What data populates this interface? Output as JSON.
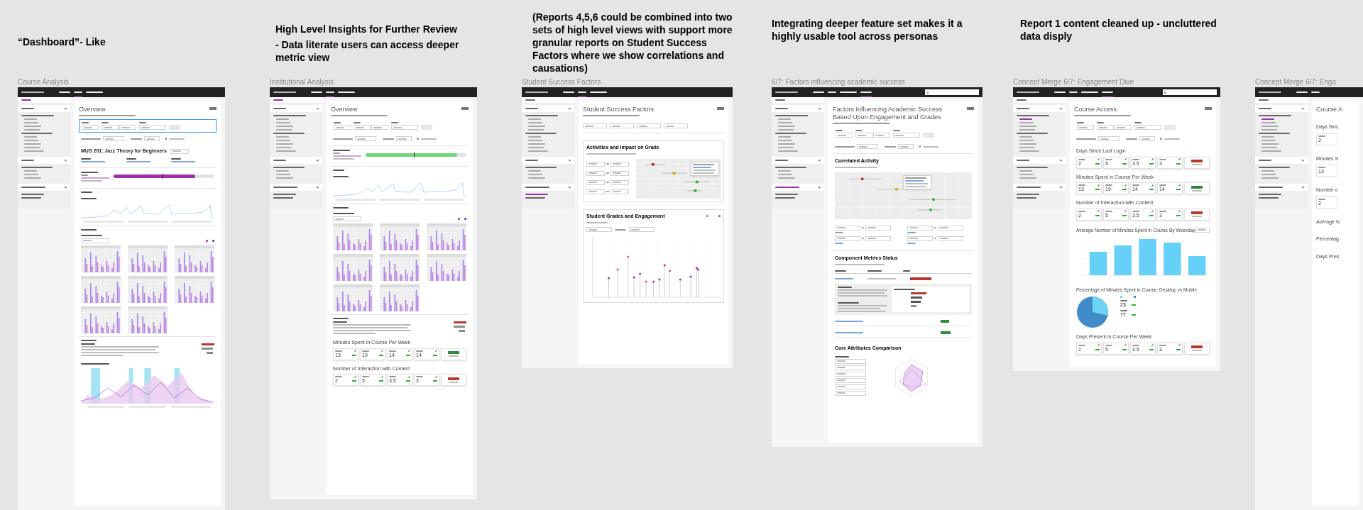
{
  "annotations": [
    {
      "lines": [
        "“Dashboard”- Like"
      ]
    },
    {
      "lines": [
        "High Level Insights for Further Review",
        "- Data literate users can access deeper metric view"
      ]
    },
    {
      "lines": [
        "(Reports 4,5,6 could be combined into two sets of high level views with support more granular reports on Student Success Factors where we show correlations and causations)"
      ]
    },
    {
      "lines": [
        "Integrating deeper feature set makes it a highly usable tool across personas"
      ]
    },
    {
      "lines": [
        "Report 1 content cleaned up - uncluttered data disply"
      ]
    }
  ],
  "frames": [
    {
      "title": "Course Analysis",
      "nav": {
        "kind": "reports"
      },
      "sidebar": {
        "kind": "top"
      },
      "page_title": "Overview",
      "blocks": [
        {
          "kind": "filters",
          "highlighted": true
        },
        {
          "kind": "course",
          "title": "MUS 201: Jazz Theory for Beginners"
        },
        {
          "kind": "enrollment",
          "level": 0.81,
          "color": "#9b2fae"
        },
        {
          "kind": "sparkline"
        },
        {
          "kind": "minigrid"
        },
        {
          "kind": "summary"
        },
        {
          "kind": "area"
        }
      ]
    },
    {
      "title": "Institutional Analysis",
      "nav": {
        "kind": "reports"
      },
      "sidebar": {
        "kind": "top"
      },
      "page_title": "Overview",
      "blocks": [
        {
          "kind": "filters",
          "highlighted": false
        },
        {
          "kind": "enrollment",
          "level": 0.91,
          "color": "#6fd67a"
        },
        {
          "kind": "sparkline"
        },
        {
          "kind": "minigrid"
        },
        {
          "kind": "summary"
        },
        {
          "kind": "metric",
          "title": "Minutes Spent in Course Per Week",
          "values": [
            "13",
            "19",
            "14",
            "14"
          ],
          "status": {
            "color": "#2e8b3a"
          }
        },
        {
          "kind": "metric",
          "title": "Number of Interaction with Content",
          "values": [
            "2",
            "5",
            "3.5",
            "3"
          ],
          "status": {
            "color": "#b8372f"
          }
        }
      ]
    },
    {
      "title": "Student Success Factors",
      "nav": {
        "kind": "reports"
      },
      "sidebar": {
        "kind": "group"
      },
      "page_title": "Student Success Factors",
      "blocks": [
        {
          "kind": "selects"
        },
        {
          "kind": "dotcard",
          "title": "Activities and Impact on Grade",
          "dots": [
            {
              "color": "#c0282d"
            },
            {
              "color": "#d9a514"
            },
            {
              "color": "#2fae3c"
            },
            {
              "color": "#2fae3c"
            }
          ]
        },
        {
          "kind": "scattercard",
          "title": "Student Grades and Engagement"
        }
      ]
    },
    {
      "title": "6/7: Factors influencing academic success",
      "nav": {
        "kind": "codename"
      },
      "sidebar": {
        "kind": "section"
      },
      "page_title": "Factors Influencing Academic Success Based Upon Engagement and Grades",
      "blocks": [
        {
          "kind": "filters",
          "highlighted": false
        },
        {
          "kind": "dotplot",
          "title": "Correlated Activity",
          "dots": [
            {
              "color": "#c0282d"
            },
            {
              "color": "#d9a514"
            },
            {
              "color": "#2fae3c"
            },
            {
              "color": "#2fae3c"
            }
          ]
        },
        {
          "kind": "pairs"
        },
        {
          "kind": "risk",
          "title": "Component Metrics Status"
        },
        {
          "kind": "radar",
          "title": "Core Attributes Comparison"
        }
      ]
    },
    {
      "title": "Concept Merge 6/7: Engagement Dive",
      "nav": {
        "kind": "codename"
      },
      "sidebar": {
        "kind": "item"
      },
      "page_title": "Course Access",
      "blocks": [
        {
          "kind": "filters",
          "highlighted": false
        },
        {
          "kind": "metric",
          "title": "Days Since Last Login",
          "values": [
            "2",
            "5",
            "3.5",
            "3"
          ],
          "status": {
            "color": "#b8372f"
          }
        },
        {
          "kind": "metric",
          "title": "Minutes Spent in Course Per Week",
          "values": [
            "13",
            "19",
            "14",
            "14"
          ],
          "status": {
            "color": "#2e8b3a"
          }
        },
        {
          "kind": "metric",
          "title": "Number of Interaction with Content",
          "values": [
            "2",
            "5",
            "3.5",
            "3"
          ],
          "status": {
            "color": "#b8372f"
          }
        },
        {
          "kind": "weekday",
          "title": "Average Number of Minutes Spent in Course By Weekday"
        },
        {
          "kind": "pie",
          "title": "Percentage of Minutes Spent in Course: Desktop vs Mobile",
          "values": [
            "23",
            "77"
          ]
        },
        {
          "kind": "metric",
          "title": "Days Present in Course Per Week",
          "values": [
            "2",
            "5",
            "3.5",
            "3"
          ],
          "status": {
            "color": "#b8372f"
          }
        }
      ]
    },
    {
      "title": "Concept Merge 6/7: Enga",
      "nav": {
        "kind": "cut"
      },
      "sidebar": {
        "kind": "item"
      },
      "page_title": "Course A",
      "blocks": [
        {
          "kind": "stub",
          "title": "Days Sinc",
          "values": [
            "2"
          ]
        },
        {
          "kind": "stub",
          "title": "Minutes S",
          "values": [
            "13"
          ]
        },
        {
          "kind": "stub",
          "title": "Number o",
          "values": [
            "2"
          ]
        },
        {
          "kind": "stub",
          "title": "Average N"
        },
        {
          "kind": "stub",
          "title": "Percentag"
        },
        {
          "kind": "stub",
          "title": "Days Pres"
        }
      ]
    }
  ]
}
